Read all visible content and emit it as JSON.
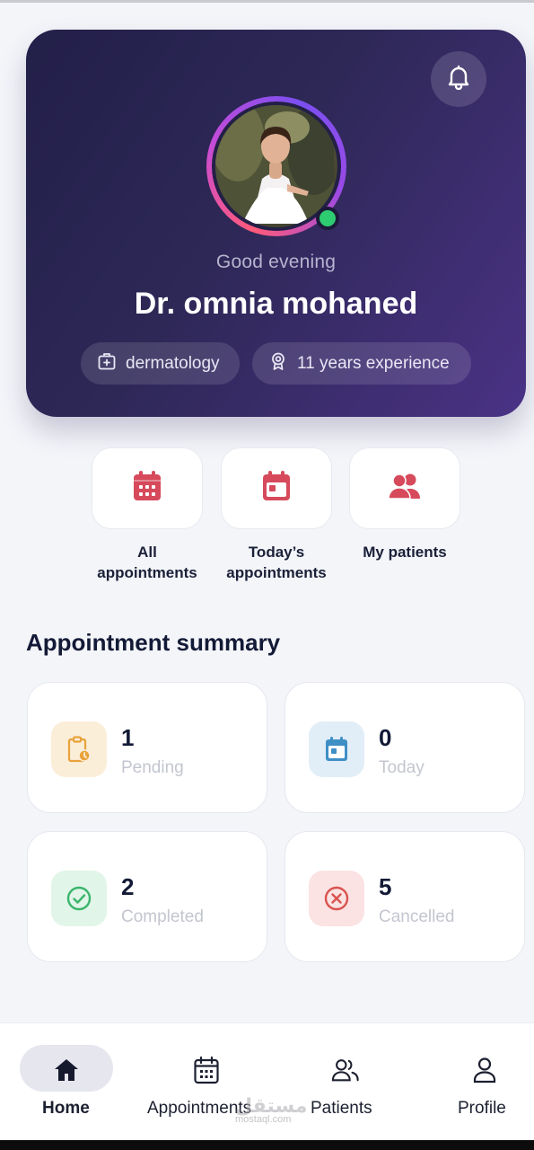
{
  "header": {
    "greeting": "Good evening",
    "doctor_name": "Dr. omnia mohaned",
    "specialty": "dermatology",
    "experience": "11 years experience",
    "online_status_color": "#2ecc71"
  },
  "quick_actions": [
    {
      "label": "All\nappointments",
      "icon": "calendar-grid-icon"
    },
    {
      "label": "Today’s\nappointments",
      "icon": "calendar-today-icon"
    },
    {
      "label": "My patients",
      "icon": "users-icon"
    }
  ],
  "summary": {
    "title": "Appointment summary",
    "cards": [
      {
        "count": "1",
        "label": "Pending",
        "icon": "clipboard-clock-icon",
        "color": "#e8a23c"
      },
      {
        "count": "0",
        "label": "Today",
        "icon": "calendar-icon",
        "color": "#3f8fc6"
      },
      {
        "count": "2",
        "label": "Completed",
        "icon": "check-circle-icon",
        "color": "#3bb56c"
      },
      {
        "count": "5",
        "label": "Cancelled",
        "icon": "x-circle-icon",
        "color": "#d9534f"
      }
    ]
  },
  "bottom_nav": {
    "items": [
      {
        "label": "Home",
        "icon": "home-icon",
        "active": true
      },
      {
        "label": "Appointments",
        "icon": "calendar-icon",
        "active": false
      },
      {
        "label": "Patients",
        "icon": "users-icon",
        "active": false
      },
      {
        "label": "Profile",
        "icon": "user-icon",
        "active": false
      }
    ]
  },
  "watermark": {
    "text": "مستقل",
    "sub": "mostaql.com"
  },
  "colors": {
    "accent_red": "#d64a5c",
    "hero_dark": "#221f49",
    "hero_purple": "#4a3285"
  }
}
